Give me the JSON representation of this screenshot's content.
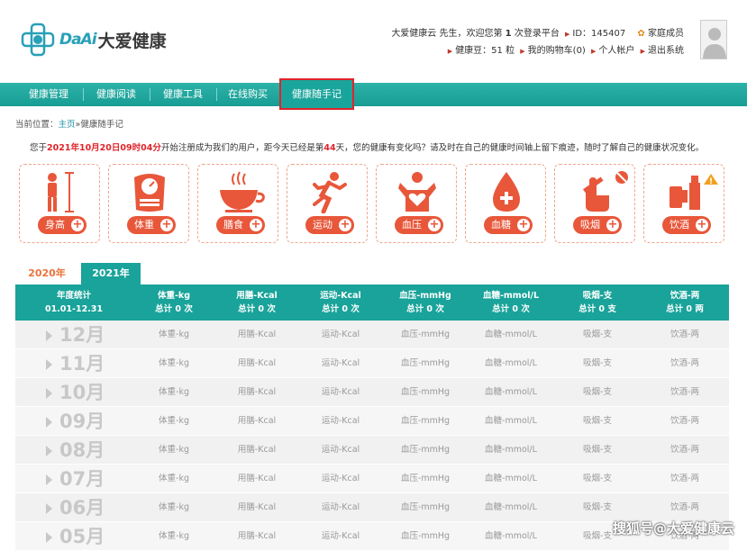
{
  "logo": {
    "en": "DaAi",
    "cn": "大爱健康"
  },
  "user": {
    "greeting_prefix": "大爱健康云 先生，欢迎您第 ",
    "login_count": "1",
    "greeting_suffix": " 次登录平台",
    "id_label": "ID：145407",
    "family": "家庭成员",
    "beans": "健康豆：51 粒",
    "cart": "我的购物车(0)",
    "account": "个人帐户",
    "logout": "退出系统"
  },
  "nav": {
    "items": [
      "健康管理",
      "健康阅读",
      "健康工具",
      "在线购买",
      "健康随手记"
    ],
    "active": "健康随手记"
  },
  "breadcrumb": {
    "prefix": "当前位置：",
    "home": "主页",
    "sep": "»",
    "current": "健康随手记"
  },
  "notice": {
    "p1": "您于",
    "date": "2021年10月20日09时04分",
    "p2": "开始注册成为我们的用户，距今天已经是第",
    "days": "44",
    "p3": "天，您的健康有变化吗？请及时在自己的健康时间轴上留下痕迹，随时了解自己的健康状况变化。"
  },
  "cards": [
    {
      "label": "身高",
      "icon": "height-icon"
    },
    {
      "label": "体重",
      "icon": "scale-icon"
    },
    {
      "label": "膳食",
      "icon": "food-bowl-icon"
    },
    {
      "label": "运动",
      "icon": "running-icon"
    },
    {
      "label": "血压",
      "icon": "heart-person-icon"
    },
    {
      "label": "血糖",
      "icon": "blood-drop-icon"
    },
    {
      "label": "吸烟",
      "icon": "cigarette-icon"
    },
    {
      "label": "饮酒",
      "icon": "beer-icon"
    }
  ],
  "year_tabs": [
    {
      "label": "2020年",
      "active": false
    },
    {
      "label": "2021年",
      "active": true
    }
  ],
  "table": {
    "headers": [
      {
        "l1": "年度统计",
        "l2": "01.01-12.31"
      },
      {
        "l1": "体重-kg",
        "l2": "总计 0 次"
      },
      {
        "l1": "用膳-Kcal",
        "l2": "总计 0 次"
      },
      {
        "l1": "运动-Kcal",
        "l2": "总计 0 次"
      },
      {
        "l1": "血压-mmHg",
        "l2": "总计 0 次"
      },
      {
        "l1": "血糖-mmol/L",
        "l2": "总计 0 次"
      },
      {
        "l1": "吸烟-支",
        "l2": "总计 0 支"
      },
      {
        "l1": "饮酒-两",
        "l2": "总计 0 两"
      }
    ],
    "row_cells": [
      "体重-kg",
      "用膳-Kcal",
      "运动-Kcal",
      "血压-mmHg",
      "血糖-mmol/L",
      "吸烟-支",
      "饮酒-两"
    ],
    "months": [
      "12月",
      "11月",
      "10月",
      "09月",
      "08月",
      "07月",
      "06月",
      "05月"
    ]
  },
  "watermark": "搜狐号@大爱健康云",
  "colors": {
    "teal": "#19a39a",
    "orange": "#e8573a",
    "red_highlight": "#e0242a"
  }
}
